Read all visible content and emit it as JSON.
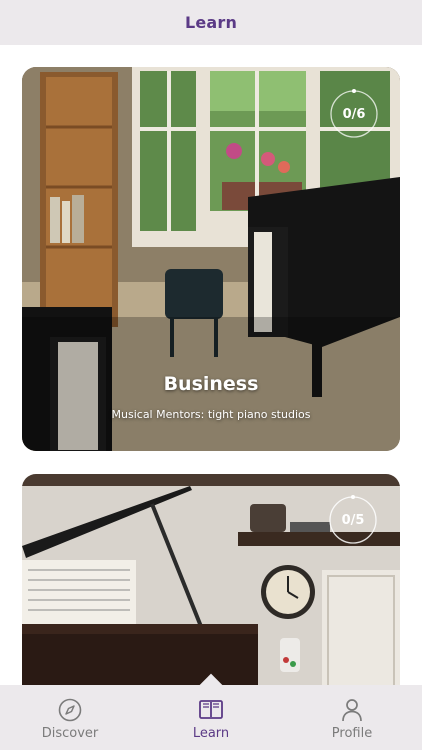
{
  "header": {
    "title": "Learn"
  },
  "cards": [
    {
      "title": "Business",
      "subtitle": "Musical Mentors: tight piano studios",
      "progress": "0/6",
      "progress_fraction": 0.0
    },
    {
      "title": "",
      "subtitle": "",
      "progress": "0/5",
      "progress_fraction": 0.0
    }
  ],
  "tabs": [
    {
      "label": "Discover",
      "icon": "compass-icon",
      "active": false
    },
    {
      "label": "Learn",
      "icon": "book-icon",
      "active": true
    },
    {
      "label": "Profile",
      "icon": "person-icon",
      "active": false
    }
  ],
  "colors": {
    "accent": "#5b3a86",
    "bar_background": "#ece9ec",
    "inactive": "#7b7b7b"
  }
}
